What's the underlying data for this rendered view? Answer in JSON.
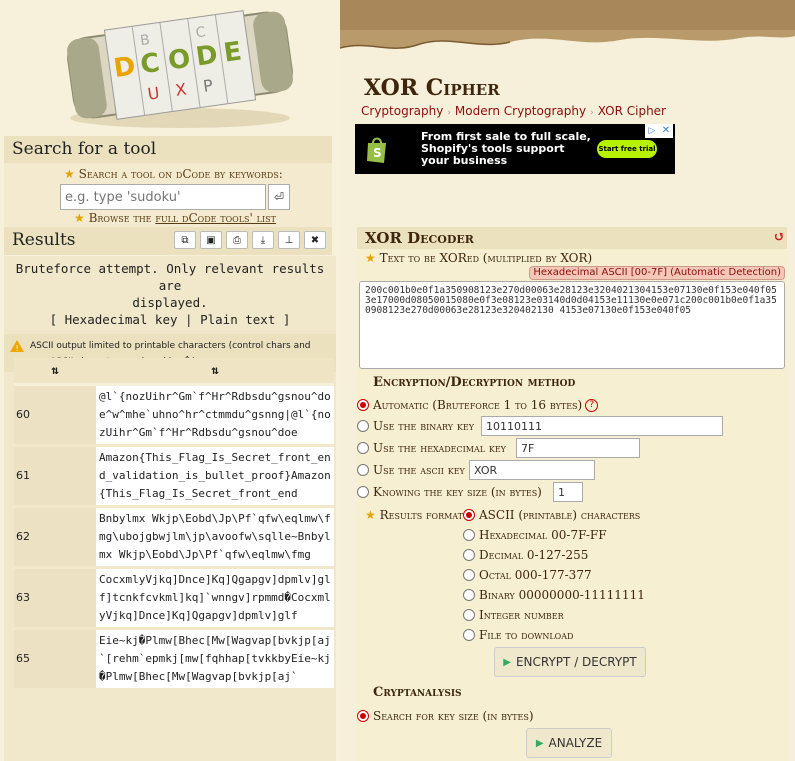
{
  "logo": {
    "brand": "dCODE"
  },
  "search": {
    "title": "Search for a tool",
    "hint": "Search a tool on dCode by keywords:",
    "placeholder": "e.g. type 'sudoku'",
    "browse_prefix": "Browse the ",
    "browse_link": "full dCode tools' list"
  },
  "results": {
    "title": "Results",
    "tools": [
      "copy-icon",
      "save-icon",
      "print-icon",
      "download-icon",
      "pin-icon",
      "close-icon"
    ],
    "bruteforce_note_1": "Bruteforce attempt. Only relevant results are",
    "bruteforce_note_2": "displayed.",
    "bruteforce_note_3": "[ Hexadecimal key | Plain text ]",
    "warning": "ASCII output limited to printable characters (control chars and non-ASCII characters replaced by �)",
    "columns": [
      "⇅",
      "⇅"
    ],
    "rows": [
      {
        "key": "60",
        "text": "@l`{nozUihr^Gm`f^Hr^Rdbsdu^gsnou^doe^w^mhe`uhno^hr^ctmmdu^gsnng|@l`{nozUihr^Gm`f^Hr^Rdbsdu^gsnou^doe"
      },
      {
        "key": "61",
        "text": "Amazon{This_Flag_Is_Secret_front_end_validation_is_bullet_proof}Amazon{This_Flag_Is_Secret_front_end"
      },
      {
        "key": "62",
        "text": "Bnbylmx Wkjp\\Eobd\\Jp\\Pf`qfw\\eqlmw\\fmg\\ubojgbwjlm\\jp\\avoofw\\sqlle~Bnbylmx Wkjp\\Eobd\\Jp\\Pf`qfw\\eqlmw\\fmg"
      },
      {
        "key": "63",
        "text": "CocxmlyVjkq]Dnce]Kq]Qgapgv]dpmlv]glf]tcnkfcvkml]kq]`wnngv]rpmmd�CocxmlyVjkq]Dnce]Kq]Qgapgv]dpmlv]glf"
      },
      {
        "key": "65",
        "text": "Eie~kj�Plmw[Bhec[Mw[Wagvap[bvkjp[aj`[rehm`epmkj[mw[fqhhap[tvkkbyEie~kj�Plmw[Bhec[Mw[Wagvap[bvkjp[aj`"
      }
    ]
  },
  "page": {
    "title": "XOR Cipher",
    "breadcrumb": [
      "Cryptography",
      "Modern Cryptography",
      "XOR Cipher"
    ]
  },
  "ad": {
    "text": "From first sale to full scale, Shopify's tools support your business",
    "cta": "Start free trial"
  },
  "decoder": {
    "title": "XOR Decoder",
    "text_label": "Text to be XORed (multiplied by XOR)",
    "detect_badge": "Hexadecimal ASCII [00-7F] (Automatic Detection)",
    "cipher_text": "200c001b0e0f1a350908123e270d00063e28123e3204021304153e07130e0f153e040f053e17000d08050015080e0f3e08123e03140d0d04153e11130e0e071c200c001b0e0f1a350908123e270d00063e28123e320402130 4153e07130e0f153e040f05",
    "enc_head": "Encryption/Decryption method",
    "methods": {
      "auto": "Automatic (Bruteforce 1 to 16 bytes)",
      "binary": "Use the binary key",
      "hex": "Use the hexadecimal key",
      "ascii": "Use the ascii key",
      "size": "Knowing the key size (in bytes)"
    },
    "binary_key": "10110111",
    "hex_key": "7F",
    "ascii_key": "XOR",
    "key_size": "1",
    "format_label": "Results format",
    "formats": [
      "ASCII (printable) characters",
      "Hexadecimal 00-7F-FF",
      "Decimal 0-127-255",
      "Octal 000-177-377",
      "Binary 00000000-11111111",
      "Integer number",
      "File to download"
    ],
    "encrypt_button": "ENCRYPT / DECRYPT",
    "crypt_head": "Cryptanalysis",
    "keysize_search": "Search for key size (in bytes)",
    "analyze_button": "ANALYZE"
  },
  "colors": {
    "accent": "#8a0e0e",
    "selected_radio": "#cc0000",
    "section_bg": "#ebe1bf"
  }
}
